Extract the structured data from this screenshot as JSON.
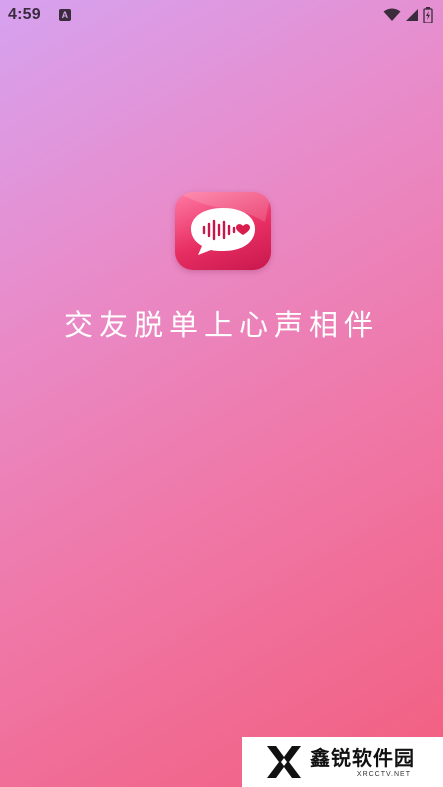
{
  "status_bar": {
    "time": "4:59",
    "notification_letter": "A",
    "icons": [
      "wifi-icon",
      "signal-icon",
      "battery-charging-icon"
    ]
  },
  "splash": {
    "logo_icon": "voice-bubble-heart-icon",
    "slogan": "交友脱单上心声相伴"
  },
  "colors": {
    "gradient_start": "#d6a2f0",
    "gradient_end": "#f25e7f",
    "logo_red": "#e82f63",
    "heart": "#d81e4c"
  },
  "watermark": {
    "title": "鑫锐软件园",
    "subtitle": "XRCCTV.NET"
  }
}
